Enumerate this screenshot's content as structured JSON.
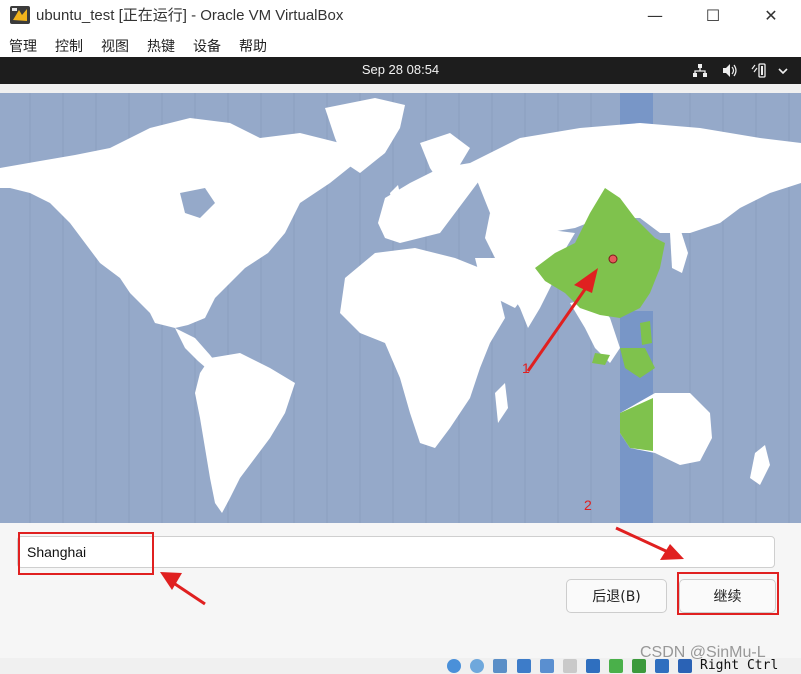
{
  "window": {
    "title": "ubuntu_test [正在运行] - Oracle VM VirtualBox",
    "minimize_glyph": "—",
    "maximize_glyph": "☐",
    "close_glyph": "✕"
  },
  "menubar": {
    "items": [
      "管理",
      "控制",
      "视图",
      "热键",
      "设备",
      "帮助"
    ]
  },
  "panel": {
    "clock": "Sep 28  08:54",
    "icons": [
      "network-icon",
      "volume-icon",
      "battery-icon",
      "power-menu-icon"
    ]
  },
  "timezone_map": {
    "selected_region": "China",
    "highlight_color": "#7fc24d",
    "ocean_color": "#95a9c9",
    "land_color": "#ffffff",
    "timezone_band_color": "#7896c7"
  },
  "location": {
    "value": "Shanghai"
  },
  "buttons": {
    "back": "后退(B)",
    "continue": "继续"
  },
  "annotations": {
    "label_1": "1",
    "label_2": "2",
    "color": "#e02020"
  },
  "statusbar": {
    "host_key": "Right Ctrl"
  },
  "watermark": "CSDN @SinMu-L"
}
